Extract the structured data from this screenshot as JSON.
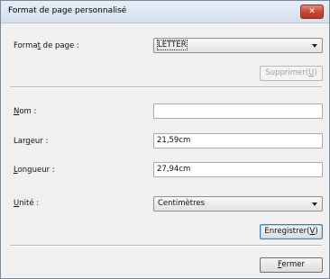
{
  "window": {
    "title": "Format de page personnalisé",
    "close_glyph": "✕"
  },
  "page_format": {
    "label_pre": "Forma",
    "label_key": "t",
    "label_post": " de page :",
    "selected": "LETTER",
    "delete_pre": "Supprimer(",
    "delete_key": "U",
    "delete_post": ")"
  },
  "name": {
    "label_key": "N",
    "label_post": "om :",
    "value": ""
  },
  "width": {
    "label_pre": "Lar",
    "label_key": "g",
    "label_post": "eur :",
    "value": "21,59cm"
  },
  "length": {
    "label_key": "L",
    "label_post": "ongueur :",
    "value": "27,94cm"
  },
  "unit": {
    "label_key": "U",
    "label_post": "nité :",
    "selected": "Centimètres"
  },
  "save": {
    "pre": "Enregistrer(",
    "key": "V",
    "post": ")"
  },
  "close": {
    "key": "F",
    "post": "ermer"
  },
  "colors": {
    "title_bar": "#d4e0ec",
    "close_button": "#c5462f",
    "dialog_bg": "#f0f0f0",
    "disabled_text": "#a0a0a0"
  }
}
